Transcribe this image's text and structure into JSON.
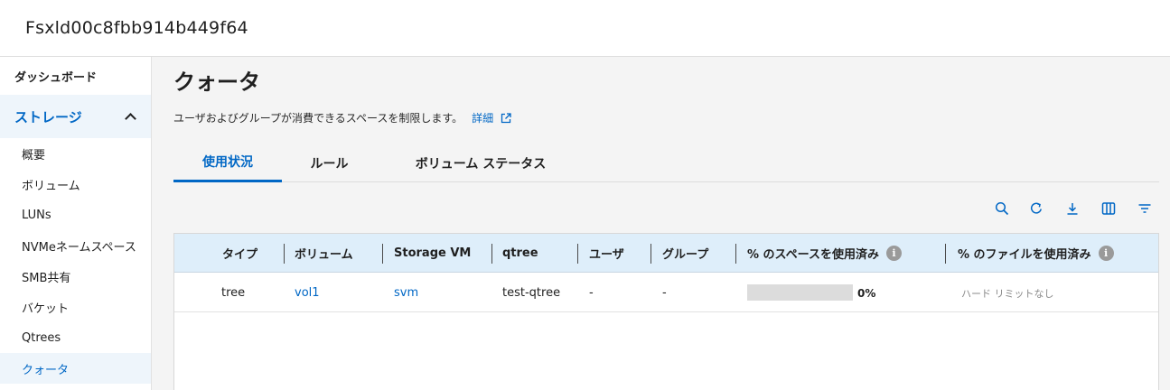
{
  "app": {
    "title": "Fsxld00c8fbb914b449f64"
  },
  "sidebar": {
    "dashboard": "ダッシュボード",
    "storage": "ストレージ",
    "items": [
      {
        "label": "概要"
      },
      {
        "label": "ボリューム"
      },
      {
        "label": "LUNs"
      },
      {
        "label": "NVMeネームスペース"
      },
      {
        "label": "SMB共有"
      },
      {
        "label": "バケット"
      },
      {
        "label": "Qtrees"
      },
      {
        "label": "クォータ"
      }
    ]
  },
  "page": {
    "title": "クォータ",
    "description": "ユーザおよびグループが消費できるスペースを制限します。",
    "details_link": "詳細"
  },
  "tabs": [
    "使用状況",
    "ルール",
    "ボリューム ステータス"
  ],
  "toolbar": {
    "icons": [
      "search-icon",
      "refresh-icon",
      "download-icon",
      "columns-icon",
      "filter-icon"
    ]
  },
  "table": {
    "columns": [
      "タイプ",
      "ボリューム",
      "Storage VM",
      "qtree",
      "ユーザ",
      "グループ",
      "% のスペースを使用済み",
      "% のファイルを使用済み"
    ],
    "rows": [
      {
        "type": "tree",
        "volume": "vol1",
        "svm": "svm",
        "qtree": "test-qtree",
        "user": "-",
        "group": "-",
        "space_used_fraction": 0,
        "space_used_pct": "0%",
        "files_used": "ハード リミットなし"
      }
    ]
  },
  "colors": {
    "accent": "#0067c5",
    "header_bg": "#deeefa",
    "selected_bg": "#eef5fb"
  }
}
